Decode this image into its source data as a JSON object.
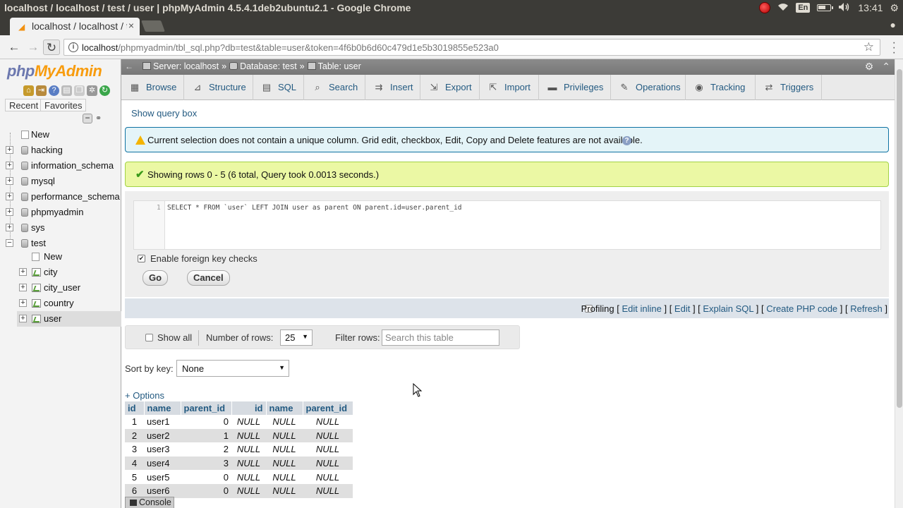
{
  "os": {
    "window_title": "localhost / localhost / test / user | phpMyAdmin 4.5.4.1deb2ubuntu2.1 - Google Chrome",
    "lang": "En",
    "clock": "13:41"
  },
  "browser": {
    "tab_title": "localhost / localhost / test / user | phpMyAdmin",
    "url_host": "localhost",
    "url_path": "/phpmyadmin/tbl_sql.php?db=test&table=user&token=4f6b0b6d60c479d1e5b3019855e523a0"
  },
  "nav": {
    "logo_php": "php",
    "logo_myadmin": "MyAdmin",
    "recent_label": "Recent",
    "favorites_label": "Favorites",
    "tree": [
      {
        "label": "New",
        "kind": "new"
      },
      {
        "label": "hacking",
        "kind": "db"
      },
      {
        "label": "information_schema",
        "kind": "db"
      },
      {
        "label": "mysql",
        "kind": "db"
      },
      {
        "label": "performance_schema",
        "kind": "db"
      },
      {
        "label": "phpmyadmin",
        "kind": "db"
      },
      {
        "label": "sys",
        "kind": "db"
      },
      {
        "label": "test",
        "kind": "db-open"
      },
      {
        "label": "New",
        "kind": "sub-new"
      },
      {
        "label": "city",
        "kind": "table"
      },
      {
        "label": "city_user",
        "kind": "table"
      },
      {
        "label": "country",
        "kind": "table"
      },
      {
        "label": "user",
        "kind": "table-selected"
      }
    ]
  },
  "breadcrumb": {
    "server": "Server: localhost",
    "database": "Database: test",
    "table": "Table: user",
    "sep": "»"
  },
  "menu_tabs": [
    {
      "label": "Browse",
      "icon": "browse-icon"
    },
    {
      "label": "Structure",
      "icon": "structure-icon"
    },
    {
      "label": "SQL",
      "icon": "sql-icon"
    },
    {
      "label": "Search",
      "icon": "search-icon"
    },
    {
      "label": "Insert",
      "icon": "insert-icon"
    },
    {
      "label": "Export",
      "icon": "export-icon"
    },
    {
      "label": "Import",
      "icon": "import-icon"
    },
    {
      "label": "Privileges",
      "icon": "privileges-icon"
    },
    {
      "label": "Operations",
      "icon": "operations-icon"
    },
    {
      "label": "Tracking",
      "icon": "tracking-icon"
    },
    {
      "label": "Triggers",
      "icon": "triggers-icon"
    }
  ],
  "content": {
    "show_query_box": "Show query box",
    "warning": "Current selection does not contain a unique column. Grid edit, checkbox, Edit, Copy and Delete features are not available.",
    "success": "Showing rows 0 - 5 (6 total, Query took 0.0013 seconds.)",
    "sql_line_number": "1",
    "sql_query": "SELECT * FROM `user` LEFT JOIN user as parent ON parent.id=user.parent_id",
    "fk_checks_label": "Enable foreign key checks",
    "go_label": "Go",
    "cancel_label": "Cancel",
    "profiling_label": "Profiling",
    "links": {
      "edit_inline": "Edit inline",
      "edit": "Edit",
      "explain_sql": "Explain SQL",
      "create_php_code": "Create PHP code",
      "refresh": "Refresh"
    },
    "show_all_label": "Show all",
    "number_of_rows_label": "Number of rows:",
    "number_of_rows_value": "25",
    "filter_rows_label": "Filter rows:",
    "filter_placeholder": "Search this table",
    "sort_by_key_label": "Sort by key:",
    "sort_by_key_value": "None",
    "options_link": "+ Options",
    "console_label": "Console"
  },
  "results": {
    "columns": [
      "id",
      "name",
      "parent_id",
      "id",
      "name",
      "parent_id"
    ],
    "rows": [
      [
        "1",
        "user1",
        "0",
        "NULL",
        "NULL",
        "NULL"
      ],
      [
        "2",
        "user2",
        "1",
        "NULL",
        "NULL",
        "NULL"
      ],
      [
        "3",
        "user3",
        "2",
        "NULL",
        "NULL",
        "NULL"
      ],
      [
        "4",
        "user4",
        "3",
        "NULL",
        "NULL",
        "NULL"
      ],
      [
        "5",
        "user5",
        "0",
        "NULL",
        "NULL",
        "NULL"
      ],
      [
        "6",
        "user6",
        "0",
        "NULL",
        "NULL",
        "NULL"
      ]
    ]
  }
}
